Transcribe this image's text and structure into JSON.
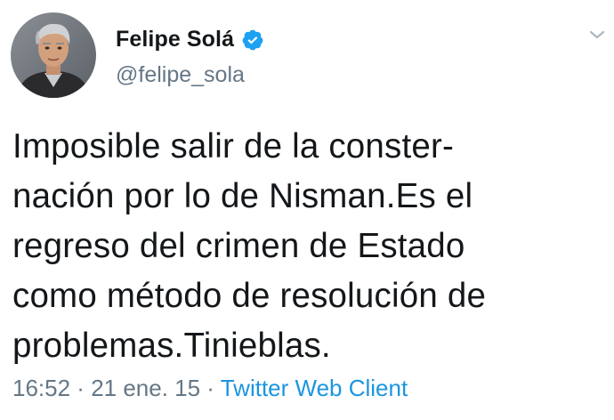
{
  "author": {
    "display_name": "Felipe Solá",
    "handle": "@felipe_sola",
    "verified": true,
    "avatar_icon": "profile-photo",
    "verified_icon": "verified-badge-icon"
  },
  "menu": {
    "icon": "chevron-down-icon"
  },
  "tweet": {
    "lines": [
      "Imposible salir de la conster-",
      "nación por lo de Nisman.Es el",
      "regreso del crimen de Estado",
      "como método de resolución de",
      "problemas.Tinieblas."
    ]
  },
  "meta": {
    "time": "16:52",
    "separator": " · ",
    "date": "21 ene. 15",
    "source": "Twitter Web Client"
  },
  "colors": {
    "text": "#14171a",
    "secondary": "#657786",
    "link": "#1b95e0",
    "verified": "#1da1f2"
  }
}
